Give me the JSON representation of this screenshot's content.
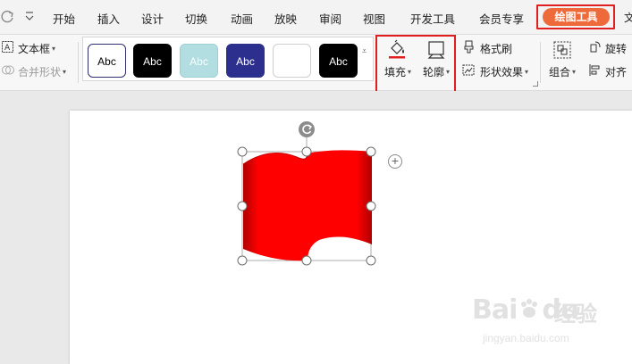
{
  "tabs": {
    "items": [
      {
        "id": "start",
        "label": "开始"
      },
      {
        "id": "insert",
        "label": "插入"
      },
      {
        "id": "design",
        "label": "设计"
      },
      {
        "id": "transition",
        "label": "切换"
      },
      {
        "id": "animation",
        "label": "动画"
      },
      {
        "id": "slideshow",
        "label": "放映"
      },
      {
        "id": "review",
        "label": "审阅"
      },
      {
        "id": "view",
        "label": "视图"
      },
      {
        "id": "developer",
        "label": "开发工具"
      },
      {
        "id": "member",
        "label": "会员专享"
      }
    ],
    "active": "绘图工具",
    "edge_char": "文"
  },
  "ribbon": {
    "textbox": "文本框",
    "merge_shapes": "合并形状",
    "style_swatch_label": "Abc",
    "style_swatches": [
      {
        "bg": "#ffffff",
        "fg": "#000000",
        "border": "#2f2f6f"
      },
      {
        "bg": "#000000",
        "fg": "#ffffff",
        "border": "#000000"
      },
      {
        "bg": "#b2dde1",
        "fg": "#ffffff",
        "border": "#9fcfd4"
      },
      {
        "bg": "#2d2f8f",
        "fg": "#ffffff",
        "border": "#2d2f8f"
      },
      {
        "bg": "#ffffff",
        "fg": "#ffffff",
        "border": "#cfcfcf"
      },
      {
        "bg": "#000000",
        "fg": "#ffffff",
        "border": "#000000"
      }
    ],
    "fill": "填充",
    "outline": "轮廓",
    "format_painter": "格式刷",
    "shape_effects": "形状效果",
    "group": "组合",
    "rotate": "旋转",
    "align": "对齐"
  },
  "colors": {
    "accent": "#ef6a3a",
    "highlight": "#e02020",
    "shape_fill": "#ff0000"
  },
  "watermark": {
    "brand": "Bai",
    "brand_tail": "du",
    "jingyan": "经验",
    "url": "jingyan.baidu.com"
  }
}
